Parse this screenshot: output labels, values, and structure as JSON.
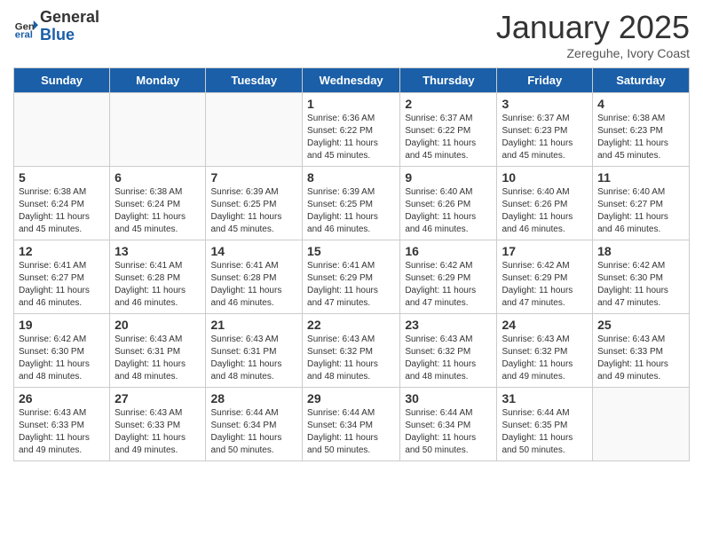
{
  "logo": {
    "general": "General",
    "blue": "Blue"
  },
  "header": {
    "month": "January 2025",
    "location": "Zereguhe, Ivory Coast"
  },
  "days_of_week": [
    "Sunday",
    "Monday",
    "Tuesday",
    "Wednesday",
    "Thursday",
    "Friday",
    "Saturday"
  ],
  "weeks": [
    [
      {
        "day": "",
        "info": ""
      },
      {
        "day": "",
        "info": ""
      },
      {
        "day": "",
        "info": ""
      },
      {
        "day": "1",
        "info": "Sunrise: 6:36 AM\nSunset: 6:22 PM\nDaylight: 11 hours and 45 minutes."
      },
      {
        "day": "2",
        "info": "Sunrise: 6:37 AM\nSunset: 6:22 PM\nDaylight: 11 hours and 45 minutes."
      },
      {
        "day": "3",
        "info": "Sunrise: 6:37 AM\nSunset: 6:23 PM\nDaylight: 11 hours and 45 minutes."
      },
      {
        "day": "4",
        "info": "Sunrise: 6:38 AM\nSunset: 6:23 PM\nDaylight: 11 hours and 45 minutes."
      }
    ],
    [
      {
        "day": "5",
        "info": "Sunrise: 6:38 AM\nSunset: 6:24 PM\nDaylight: 11 hours and 45 minutes."
      },
      {
        "day": "6",
        "info": "Sunrise: 6:38 AM\nSunset: 6:24 PM\nDaylight: 11 hours and 45 minutes."
      },
      {
        "day": "7",
        "info": "Sunrise: 6:39 AM\nSunset: 6:25 PM\nDaylight: 11 hours and 45 minutes."
      },
      {
        "day": "8",
        "info": "Sunrise: 6:39 AM\nSunset: 6:25 PM\nDaylight: 11 hours and 46 minutes."
      },
      {
        "day": "9",
        "info": "Sunrise: 6:40 AM\nSunset: 6:26 PM\nDaylight: 11 hours and 46 minutes."
      },
      {
        "day": "10",
        "info": "Sunrise: 6:40 AM\nSunset: 6:26 PM\nDaylight: 11 hours and 46 minutes."
      },
      {
        "day": "11",
        "info": "Sunrise: 6:40 AM\nSunset: 6:27 PM\nDaylight: 11 hours and 46 minutes."
      }
    ],
    [
      {
        "day": "12",
        "info": "Sunrise: 6:41 AM\nSunset: 6:27 PM\nDaylight: 11 hours and 46 minutes."
      },
      {
        "day": "13",
        "info": "Sunrise: 6:41 AM\nSunset: 6:28 PM\nDaylight: 11 hours and 46 minutes."
      },
      {
        "day": "14",
        "info": "Sunrise: 6:41 AM\nSunset: 6:28 PM\nDaylight: 11 hours and 46 minutes."
      },
      {
        "day": "15",
        "info": "Sunrise: 6:41 AM\nSunset: 6:29 PM\nDaylight: 11 hours and 47 minutes."
      },
      {
        "day": "16",
        "info": "Sunrise: 6:42 AM\nSunset: 6:29 PM\nDaylight: 11 hours and 47 minutes."
      },
      {
        "day": "17",
        "info": "Sunrise: 6:42 AM\nSunset: 6:29 PM\nDaylight: 11 hours and 47 minutes."
      },
      {
        "day": "18",
        "info": "Sunrise: 6:42 AM\nSunset: 6:30 PM\nDaylight: 11 hours and 47 minutes."
      }
    ],
    [
      {
        "day": "19",
        "info": "Sunrise: 6:42 AM\nSunset: 6:30 PM\nDaylight: 11 hours and 48 minutes."
      },
      {
        "day": "20",
        "info": "Sunrise: 6:43 AM\nSunset: 6:31 PM\nDaylight: 11 hours and 48 minutes."
      },
      {
        "day": "21",
        "info": "Sunrise: 6:43 AM\nSunset: 6:31 PM\nDaylight: 11 hours and 48 minutes."
      },
      {
        "day": "22",
        "info": "Sunrise: 6:43 AM\nSunset: 6:32 PM\nDaylight: 11 hours and 48 minutes."
      },
      {
        "day": "23",
        "info": "Sunrise: 6:43 AM\nSunset: 6:32 PM\nDaylight: 11 hours and 48 minutes."
      },
      {
        "day": "24",
        "info": "Sunrise: 6:43 AM\nSunset: 6:32 PM\nDaylight: 11 hours and 49 minutes."
      },
      {
        "day": "25",
        "info": "Sunrise: 6:43 AM\nSunset: 6:33 PM\nDaylight: 11 hours and 49 minutes."
      }
    ],
    [
      {
        "day": "26",
        "info": "Sunrise: 6:43 AM\nSunset: 6:33 PM\nDaylight: 11 hours and 49 minutes."
      },
      {
        "day": "27",
        "info": "Sunrise: 6:43 AM\nSunset: 6:33 PM\nDaylight: 11 hours and 49 minutes."
      },
      {
        "day": "28",
        "info": "Sunrise: 6:44 AM\nSunset: 6:34 PM\nDaylight: 11 hours and 50 minutes."
      },
      {
        "day": "29",
        "info": "Sunrise: 6:44 AM\nSunset: 6:34 PM\nDaylight: 11 hours and 50 minutes."
      },
      {
        "day": "30",
        "info": "Sunrise: 6:44 AM\nSunset: 6:34 PM\nDaylight: 11 hours and 50 minutes."
      },
      {
        "day": "31",
        "info": "Sunrise: 6:44 AM\nSunset: 6:35 PM\nDaylight: 11 hours and 50 minutes."
      },
      {
        "day": "",
        "info": ""
      }
    ]
  ]
}
